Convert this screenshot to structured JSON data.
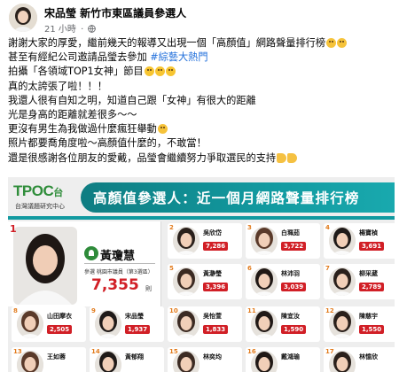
{
  "header": {
    "author": "宋品瑩 新竹市東區議員參選人",
    "time": "21 小時",
    "separator": "·"
  },
  "post": {
    "lines": [
      "謝謝大家的厚愛，繼前幾天的報導又出現一個「高顏值」網路聲量排行榜",
      "甚至有經紀公司邀請品瑩去參加",
      "拍攝「各領域TOP1女神」節目",
      "真的太誇張了啦！！！",
      "我還人很有自知之明，知道自己跟「女神」有很大的距離",
      "光是身高的距離就差很多～～",
      "更沒有男生為我做過什麼瘋狂舉動",
      "照片都要喬角度啦～高顏值什麼的，不敢當！",
      "還是很感謝各位朋友的愛戴，品瑩會繼續努力爭取選民的支持"
    ],
    "hashtag": "#綜藝大熱門"
  },
  "graphic": {
    "logo_text": "TPOC",
    "logo_suffix": "台",
    "logo_subtitle": "台灣議題研究中心",
    "title": "高顏值參選人：近一個月網路聲量排行榜",
    "top": {
      "rank": "1",
      "name": "黃瓊慧",
      "note": "參選 桃園市議員（第3選區）",
      "score": "7,355",
      "unit": "則"
    },
    "cards": [
      {
        "rank": "2",
        "name": "吳欣岱",
        "score": "7,286"
      },
      {
        "rank": "3",
        "name": "白珮茹",
        "score": "3,722"
      },
      {
        "rank": "4",
        "name": "楊寶楨",
        "score": "3,691"
      },
      {
        "rank": "5",
        "name": "黃瀞瑩",
        "score": "3,396"
      },
      {
        "rank": "6",
        "name": "林沛羽",
        "score": "3,039"
      },
      {
        "rank": "7",
        "name": "柳采葳",
        "score": "2,789"
      },
      {
        "rank": "8",
        "name": "山田摩衣",
        "score": "2,505"
      },
      {
        "rank": "9",
        "name": "宋品瑩",
        "score": "1,937"
      },
      {
        "rank": "10",
        "name": "吳怡萱",
        "score": "1,833"
      },
      {
        "rank": "11",
        "name": "陳宜汝",
        "score": "1,590"
      },
      {
        "rank": "12",
        "name": "陳慈宇",
        "score": "1,550"
      },
      {
        "rank": "13",
        "name": "王如蓉",
        "score": ""
      },
      {
        "rank": "14",
        "name": "黃郁翔",
        "score": ""
      },
      {
        "rank": "15",
        "name": "林奕均",
        "score": ""
      },
      {
        "rank": "16",
        "name": "戴鴻瑜",
        "score": ""
      },
      {
        "rank": "17",
        "name": "林憶欣",
        "score": ""
      }
    ]
  },
  "colors": {
    "teal": "#129aa0",
    "score_red": "#d11f26",
    "hashtag_blue": "#216fdb",
    "party_green": "#2e8b3a"
  }
}
